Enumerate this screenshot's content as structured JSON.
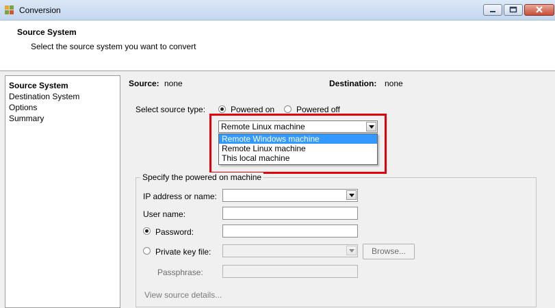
{
  "window": {
    "title": "Conversion"
  },
  "header": {
    "title": "Source System",
    "subtitle": "Select the source system you want to convert"
  },
  "nav": {
    "items": [
      "Source System",
      "Destination System",
      "Options",
      "Summary"
    ],
    "active_index": 0
  },
  "summary": {
    "source_label": "Source:",
    "source_value": "none",
    "destination_label": "Destination:",
    "destination_value": "none"
  },
  "source_type": {
    "label": "Select source type:",
    "powered_on": "Powered on",
    "powered_off": "Powered off",
    "selected": "Powered on",
    "combo_value": "Remote Linux machine",
    "options": [
      "Remote Windows machine",
      "Remote Linux machine",
      "This local machine"
    ],
    "highlighted_option_index": 0
  },
  "machine": {
    "group_title": "Specify the powered on machine",
    "ip_label": "IP address or name:",
    "ip_value": "",
    "user_label": "User name:",
    "user_value": "",
    "password_label": "Password:",
    "password_value": "",
    "key_label": "Private key file:",
    "browse_label": "Browse...",
    "passphrase_label": "Passphrase:",
    "view_details": "View source details..."
  },
  "colors": {
    "highlight": "#e3000b",
    "selection": "#3399ff"
  },
  "icons": [
    "app-icon",
    "minimize-icon",
    "maximize-icon",
    "close-icon",
    "dropdown-arrow-icon"
  ]
}
